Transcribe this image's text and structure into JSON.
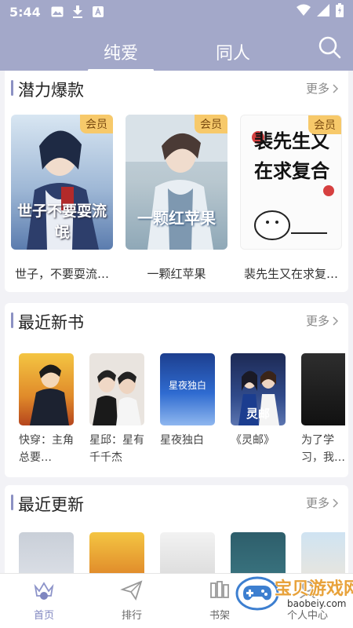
{
  "status": {
    "time": "5:44"
  },
  "header": {
    "tabs": [
      {
        "label": "纯爱"
      },
      {
        "label": "同人"
      }
    ]
  },
  "sections": [
    {
      "title": "潜力爆款",
      "more": "更多",
      "books": [
        {
          "title": "世子，不要耍流…",
          "badge": "会员",
          "cover_text": "世子不要耍流氓"
        },
        {
          "title": "一颗红苹果",
          "badge": "会员",
          "cover_text": "一颗红苹果"
        },
        {
          "title": "裴先生又在求复…",
          "badge": "会员",
          "cover_text": "裴先生又在求复合"
        }
      ]
    },
    {
      "title": "最近新书",
      "more": "更多",
      "books": [
        {
          "title": "快穿：主角总要…"
        },
        {
          "title": "星邱：星有千千杰"
        },
        {
          "title": "星夜独白",
          "cover_text": "星夜独白"
        },
        {
          "title": "《灵邮》",
          "cover_text": "灵邮"
        },
        {
          "title": "为了学习，我…"
        }
      ]
    },
    {
      "title": "最近更新",
      "more": "更多"
    }
  ],
  "nav": [
    {
      "label": "首页"
    },
    {
      "label": "排行"
    },
    {
      "label": "书架"
    },
    {
      "label": "个人中心"
    }
  ],
  "watermark": {
    "text": "宝贝游戏网",
    "url": "baobeiy.com"
  },
  "colors": {
    "header": "#a3a8c9",
    "accent": "#8b91c3",
    "vip": "#f7c96a"
  }
}
